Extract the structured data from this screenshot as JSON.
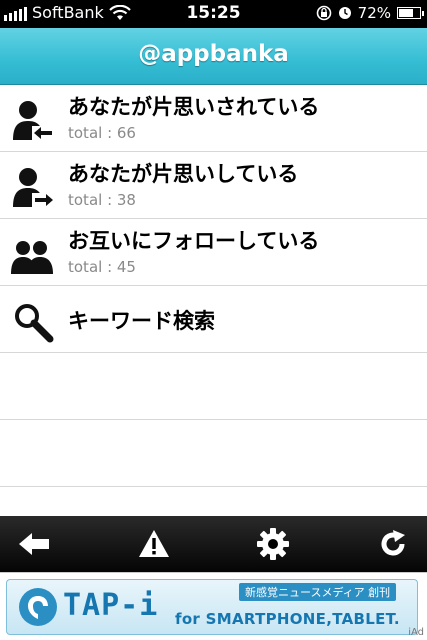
{
  "status_bar": {
    "carrier": "SoftBank",
    "time": "15:25",
    "battery": "72%",
    "battery_level": 0.72
  },
  "nav": {
    "title": "@appbanka"
  },
  "list": {
    "items": [
      {
        "title": "あなたが片思いされている",
        "subtitle": "total : 66",
        "icon": "person-arrow-in-icon"
      },
      {
        "title": "あなたが片思いしている",
        "subtitle": "total : 38",
        "icon": "person-arrow-out-icon"
      },
      {
        "title": "お互いにフォローしている",
        "subtitle": "total : 45",
        "icon": "two-people-icon"
      },
      {
        "title": "キーワード検索",
        "icon": "magnifier-icon"
      }
    ]
  },
  "toolbar": {
    "buttons": [
      "back-arrow-icon",
      "warning-icon",
      "gear-icon",
      "refresh-icon"
    ]
  },
  "ad": {
    "brand": "TAP-i",
    "tagline": "新感覚ニュースメディア 創刊",
    "subtitle": "for SMARTPHONE,TABLET.",
    "network": "iAd"
  }
}
